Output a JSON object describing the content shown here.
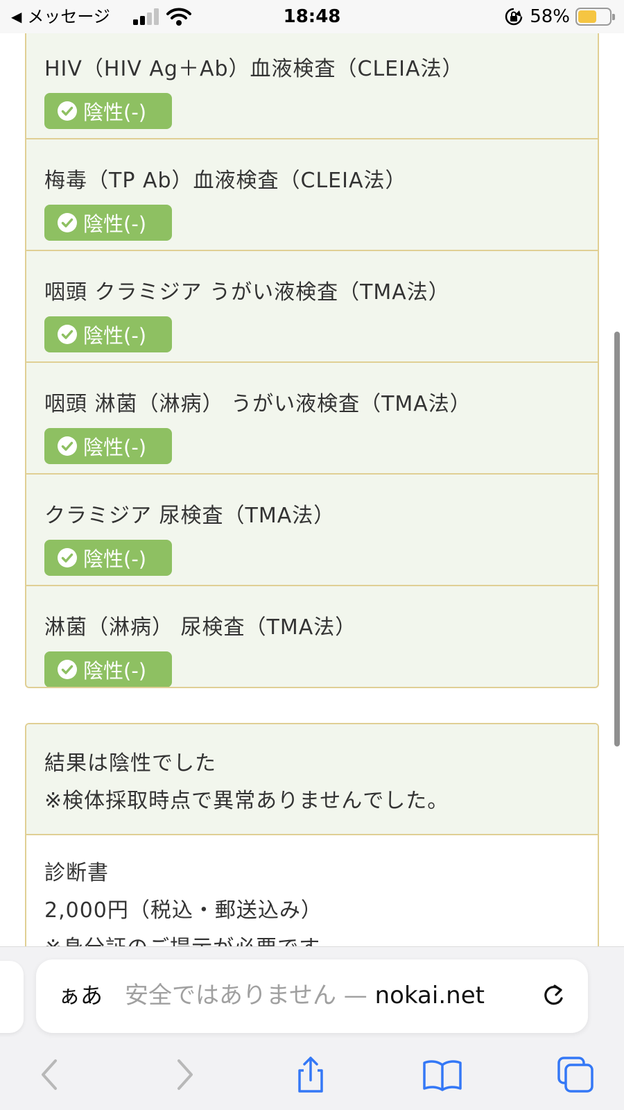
{
  "status_bar": {
    "back_label": "メッセージ",
    "time": "18:48",
    "battery": "58%",
    "battery_level": 0.58
  },
  "tests": [
    {
      "name": "HIV（HIV Ag＋Ab）血液検査（CLEIA法）",
      "result": "陰性(-)"
    },
    {
      "name": "梅毒（TP Ab）血液検査（CLEIA法）",
      "result": "陰性(-)"
    },
    {
      "name": "咽頭 クラミジア うがい液検査（TMA法）",
      "result": "陰性(-)"
    },
    {
      "name": "咽頭 淋菌（淋病） うがい液検査（TMA法）",
      "result": "陰性(-)"
    },
    {
      "name": "クラミジア 尿検査（TMA法）",
      "result": "陰性(-)"
    },
    {
      "name": "淋菌（淋病） 尿検査（TMA法）",
      "result": "陰性(-)"
    }
  ],
  "summary": {
    "line1": "結果は陰性でした",
    "line2": "※検体採取時点で異常ありませんでした。"
  },
  "certificate": {
    "title": "診断書",
    "price": "2,000円（税込・郵送込み）",
    "note": "※身分証のご提示が必要です"
  },
  "safari": {
    "aa": "ぁあ",
    "url_prefix": "安全ではありません — ",
    "url_domain": "nokai.net"
  },
  "colors": {
    "badge": "#8ec062",
    "card_bg": "#f2f6ed",
    "card_border": "#e0cf94",
    "ios_blue": "#3478f6"
  }
}
